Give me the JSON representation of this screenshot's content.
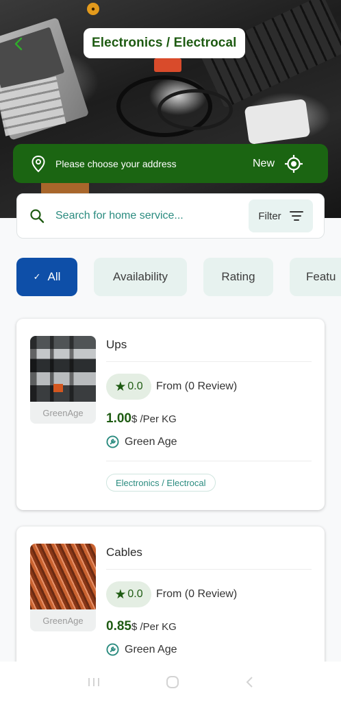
{
  "header": {
    "title": "Electronics / Electrocal",
    "address_placeholder": "Please choose your address",
    "new_label": "New"
  },
  "search": {
    "placeholder": "Search for home service...",
    "filter_label": "Filter"
  },
  "chips": [
    {
      "label": "All",
      "active": true
    },
    {
      "label": "Availability",
      "active": false
    },
    {
      "label": "Rating",
      "active": false
    },
    {
      "label": "Featu",
      "active": false
    }
  ],
  "products": [
    {
      "name": "Ups",
      "thumb_caption": "GreenAge",
      "rating": "0.0",
      "review_text": "From (0 Review)",
      "price": "1.00",
      "price_unit": "$ /Per KG",
      "provider": "Green Age",
      "category_tag": "Electronics / Electrocal"
    },
    {
      "name": "Cables",
      "thumb_caption": "GreenAge",
      "rating": "0.0",
      "review_text": "From (0 Review)",
      "price": "0.85",
      "price_unit": "$ /Per KG",
      "provider": "Green Age"
    }
  ],
  "icons": {
    "back": "arrow-left-icon",
    "location": "location-pin-icon",
    "gps": "crosshair-icon",
    "search": "search-icon",
    "filter": "filter-lines-icon",
    "check": "check-icon",
    "star": "star-icon",
    "provider": "wrench-badge-icon"
  },
  "colors": {
    "brand_green": "#1b6512",
    "active_chip": "#0e4fa8",
    "teal_text": "#2a8b7f"
  }
}
